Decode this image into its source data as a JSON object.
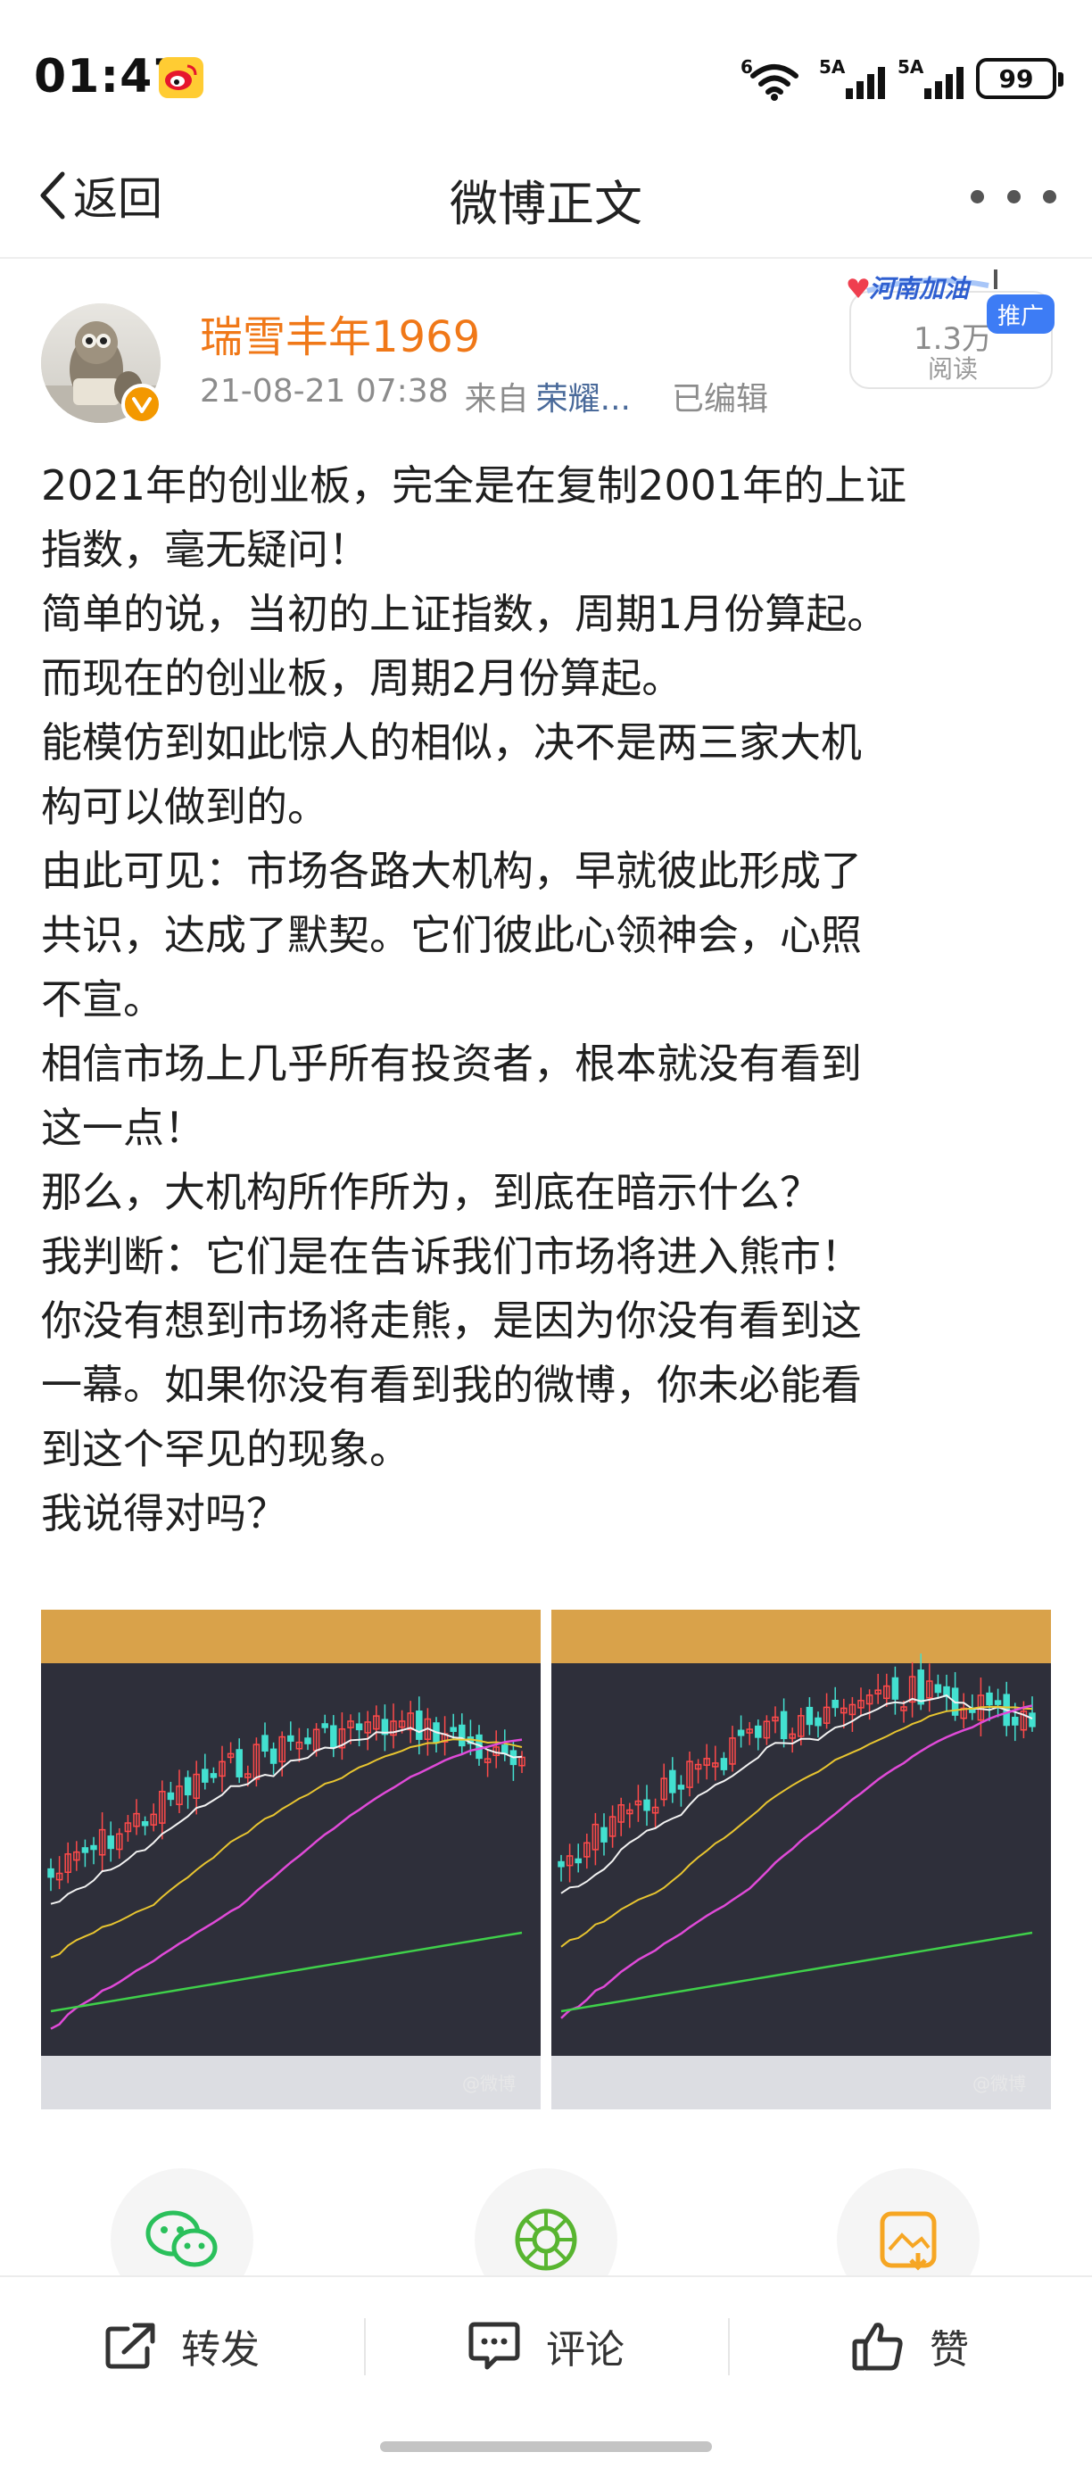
{
  "status_bar": {
    "time": "01:47",
    "signal_1_label": "6",
    "signal_2_label": "5A",
    "signal_3_label": "5A",
    "battery_level": "99"
  },
  "nav": {
    "back_label": "返回",
    "title": "微博正文"
  },
  "post": {
    "username": "瑞雪丰年1969",
    "timestamp": "21-08-21 07:38",
    "source_prefix": "来自",
    "source": "荣耀...",
    "edited": "已编辑",
    "read_count": "1.3万",
    "read_label": "阅读",
    "sticker_text": "河南加油",
    "promo_tag": "推广",
    "body_lines": [
      "2021年的创业板，完全是在复制2001年的上证",
      "指数，毫无疑问！",
      "简单的说，当初的上证指数，周期1月份算起。",
      "而现在的创业板，周期2月份算起。",
      "能模仿到如此惊人的相似，决不是两三家大机",
      "构可以做到的。",
      "由此可见：市场各路大机构，早就彼此形成了",
      "共识，达成了默契。它们彼此心领神会，心照",
      "不宣。",
      "相信市场上几乎所有投资者，根本就没有看到",
      "这一点！",
      "那么，大机构所作所为，到底在暗示什么？",
      "我判断：它们是在告诉我们市场将进入熊市！",
      "你没有想到市场将走熊，是因为你没有看到这",
      "一幕。如果你没有看到我的微博，你未必能看",
      "到这个罕见的现象。",
      "我说得对吗？"
    ],
    "image_watermark": "@微博"
  },
  "share": {
    "wechat_icon": "wechat-icon",
    "moments_icon": "moments-icon",
    "save_image_icon": "save-image-icon"
  },
  "actions": {
    "repost_label": "转发",
    "comment_label": "评论",
    "like_label": "赞"
  },
  "colors": {
    "username": "#f07818",
    "promo": "#3d7cf5",
    "verified": "#f39800",
    "wechat": "#2ac05b",
    "moments": "#58b530",
    "save": "#f6a623"
  }
}
